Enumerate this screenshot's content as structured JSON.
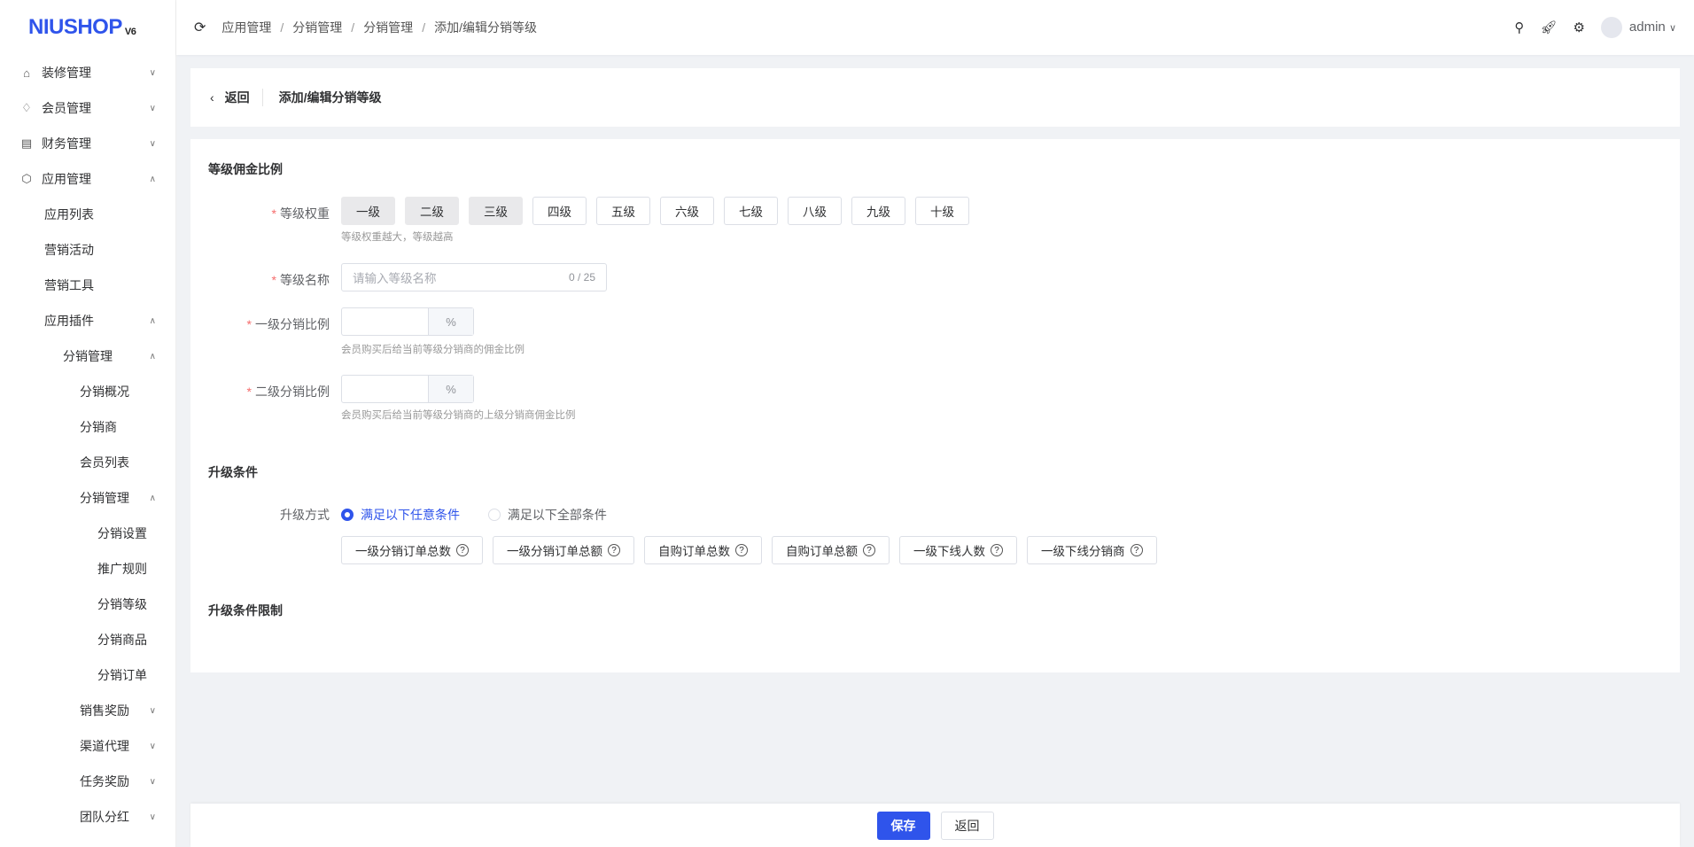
{
  "logo": {
    "text": "NIUSHOP",
    "version": "V6"
  },
  "sidebar": {
    "items": [
      {
        "label": "装修管理",
        "icon": "decoration-icon",
        "level": 0,
        "expanded": false
      },
      {
        "label": "会员管理",
        "icon": "diamond-icon",
        "level": 0,
        "expanded": false
      },
      {
        "label": "财务管理",
        "icon": "finance-icon",
        "level": 0,
        "expanded": false
      },
      {
        "label": "应用管理",
        "icon": "app-icon",
        "level": 0,
        "expanded": true
      },
      {
        "label": "应用列表",
        "level": 1
      },
      {
        "label": "营销活动",
        "level": 1
      },
      {
        "label": "营销工具",
        "level": 1
      },
      {
        "label": "应用插件",
        "level": 1,
        "expanded": true
      },
      {
        "label": "分销管理",
        "level": 2,
        "expanded": true
      },
      {
        "label": "分销概况",
        "level": 3
      },
      {
        "label": "分销商",
        "level": 3
      },
      {
        "label": "会员列表",
        "level": 3
      },
      {
        "label": "分销管理",
        "level": 3,
        "expanded": true
      },
      {
        "label": "分销设置",
        "level": 4
      },
      {
        "label": "推广规则",
        "level": 4
      },
      {
        "label": "分销等级",
        "level": 4
      },
      {
        "label": "分销商品",
        "level": 4
      },
      {
        "label": "分销订单",
        "level": 4
      },
      {
        "label": "销售奖励",
        "level": 3,
        "expanded": false
      },
      {
        "label": "渠道代理",
        "level": 3,
        "expanded": false
      },
      {
        "label": "任务奖励",
        "level": 3,
        "expanded": false
      },
      {
        "label": "团队分红",
        "level": 3,
        "expanded": false
      }
    ]
  },
  "header": {
    "breadcrumb": [
      "应用管理",
      "分销管理",
      "分销管理",
      "添加/编辑分销等级"
    ],
    "user": "admin"
  },
  "page": {
    "back": "返回",
    "title": "添加/编辑分销等级"
  },
  "form": {
    "section1": "等级佣金比例",
    "weight_label": "等级权重",
    "levels": [
      {
        "label": "一级",
        "disabled": true
      },
      {
        "label": "二级",
        "disabled": true
      },
      {
        "label": "三级",
        "disabled": true
      },
      {
        "label": "四级"
      },
      {
        "label": "五级"
      },
      {
        "label": "六级"
      },
      {
        "label": "七级"
      },
      {
        "label": "八级"
      },
      {
        "label": "九级"
      },
      {
        "label": "十级"
      }
    ],
    "weight_hint": "等级权重越大，等级越高",
    "name_label": "等级名称",
    "name_placeholder": "请输入等级名称",
    "name_count": "0 / 25",
    "ratio1_label": "一级分销比例",
    "ratio1_unit": "%",
    "ratio1_hint": "会员购买后给当前等级分销商的佣金比例",
    "ratio2_label": "二级分销比例",
    "ratio2_unit": "%",
    "ratio2_hint": "会员购买后给当前等级分销商的上级分销商佣金比例",
    "section2": "升级条件",
    "mode_label": "升级方式",
    "modes": [
      {
        "label": "满足以下任意条件",
        "checked": true
      },
      {
        "label": "满足以下全部条件",
        "checked": false
      }
    ],
    "conditions": [
      "一级分销订单总数",
      "一级分销订单总额",
      "自购订单总数",
      "自购订单总额",
      "一级下线人数",
      "一级下线分销商"
    ],
    "section3": "升级条件限制"
  },
  "footer": {
    "save": "保存",
    "back": "返回"
  },
  "colors": {
    "primary": "#2f54eb"
  }
}
